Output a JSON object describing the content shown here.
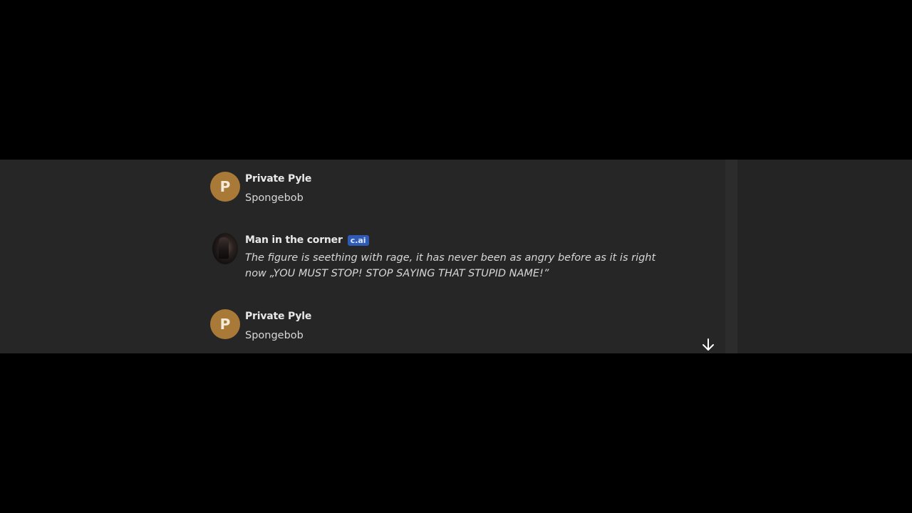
{
  "messages": [
    {
      "sender": "Private Pyle",
      "avatar_letter": "P",
      "text": "Spongebob"
    },
    {
      "sender": "Man in the corner",
      "badge": "c.ai",
      "text": "The figure is seething with rage, it has never been as angry before as it is right now „YOU MUST STOP! STOP SAYING THAT STUPID NAME!”"
    },
    {
      "sender": "Private Pyle",
      "avatar_letter": "P",
      "text": "Spongebob"
    }
  ],
  "colors": {
    "background": "#262626",
    "avatar_user": "#a97a37",
    "badge": "#2f5bb7"
  },
  "icons": {
    "scroll_down": "arrow-down-icon"
  }
}
